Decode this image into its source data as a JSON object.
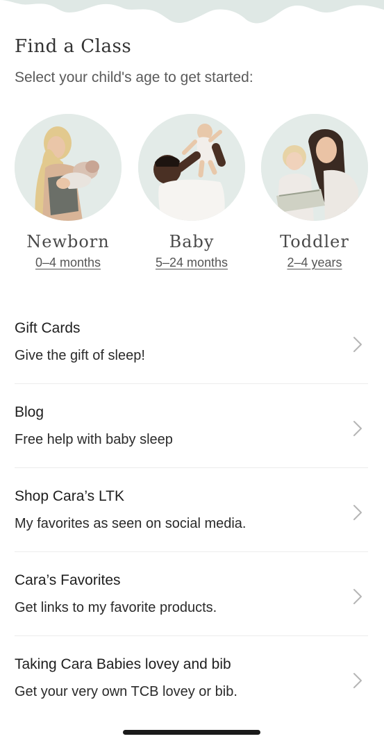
{
  "header": {
    "title": "Find a Class",
    "subtitle": "Select your child's age to get started:"
  },
  "ages": [
    {
      "name": "Newborn",
      "range": "0–4 months"
    },
    {
      "name": "Baby",
      "range": "5–24 months"
    },
    {
      "name": "Toddler",
      "range": "2–4 years"
    }
  ],
  "menu": [
    {
      "title": "Gift Cards",
      "desc": "Give the gift of sleep!"
    },
    {
      "title": "Blog",
      "desc": "Free help with baby sleep"
    },
    {
      "title": "Shop Cara’s LTK",
      "desc": "My favorites as seen on social media."
    },
    {
      "title": "Cara’s Favorites",
      "desc": "Get links to my favorite products."
    },
    {
      "title": "Taking Cara Babies lovey and bib",
      "desc": "Get your very own TCB lovey or bib."
    }
  ],
  "colors": {
    "cloud": "#dfe8e5",
    "photo_bg": "#dfe8e5",
    "chevron": "#b5b5b5",
    "divider": "#ececec"
  },
  "icons": {
    "menu_arrow": "chevron-right-icon"
  }
}
